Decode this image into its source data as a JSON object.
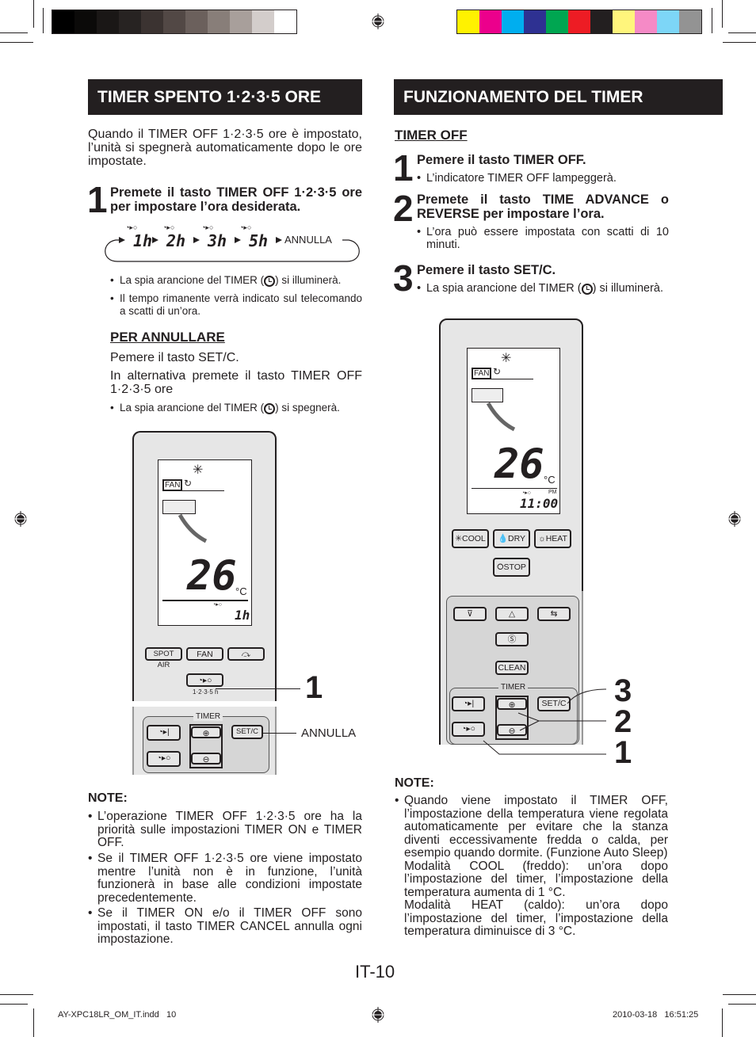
{
  "color_bars": {
    "grays": [
      "#000000",
      "#0b0a09",
      "#1a1716",
      "#272322",
      "#3b3331",
      "#524845",
      "#6b605c",
      "#887e79",
      "#a89f9b",
      "#d3cdcb",
      "#ffffff"
    ],
    "colors": [
      "#fff200",
      "#ec008c",
      "#00aeef",
      "#2e3192",
      "#00a651",
      "#ed1c24",
      "#231f20",
      "#fff57c",
      "#f58ac6",
      "#7dd6f7",
      "#939393"
    ]
  },
  "left": {
    "header": "TIMER SPENTO 1·2·3·5 ORE",
    "intro": "Quando il TIMER OFF 1·2·3·5 ore è impostato, l’unità si spegnerà automaticamente dopo le ore impostate.",
    "step1": {
      "num": "1",
      "title": "Premete il tasto TIMER OFF 1·2·3·5 ore per impostare l’ora desiderata."
    },
    "cycle": {
      "items": [
        "1h",
        "2h",
        "3h",
        "5h"
      ],
      "end": "ANNULLA"
    },
    "bullets": [
      {
        "pre": "La spia arancione del TIMER (",
        "post": ") si illuminerà."
      },
      {
        "text": "Il tempo rimanente verrà indicato sul telecomando a scatti di un’ora."
      }
    ],
    "cancel": {
      "heading": "PER ANNULLARE",
      "line1": "Pemere il tasto SET/C.",
      "line2": "In alternativa premete il tasto TIMER OFF 1·2·3·5 ore",
      "bullet_pre": "La spia arancione del TIMER (",
      "bullet_post": ") si spegnerà."
    },
    "remote": {
      "fan": "FAN",
      "temp": "26",
      "unit": "°C",
      "timer_value": "1h",
      "buttons": {
        "spot_air": "SPOT AIR",
        "fan": "FAN",
        "timer_sub": "1·2·3·5 h",
        "timer_label": "TIMER",
        "setc": "SET/C"
      },
      "callout_1": "1",
      "callout_annulla": "ANNULLA"
    },
    "note": {
      "heading": "NOTE:",
      "items": [
        "L’operazione TIMER OFF 1·2·3·5 ore ha la priorità sulle impostazioni TIMER ON  e TIMER OFF.",
        "Se il TIMER OFF 1·2·3·5 ore viene impostato mentre l’unità non è in funzione, l’unità funzionerà in base alle condizioni impostate precedentemente.",
        "Se il TIMER ON e/o il TIMER OFF sono impostati, il tasto TIMER CANCEL annulla ogni impostazione."
      ]
    }
  },
  "right": {
    "header": "FUNZIONAMENTO DEL TIMER",
    "subheading": "TIMER OFF",
    "steps": [
      {
        "num": "1",
        "title": "Pemere il tasto TIMER OFF.",
        "bullet": "L’indicatore TIMER OFF lampeggerà."
      },
      {
        "num": "2",
        "title": "Premete il tasto TIME ADVANCE o REVERSE per impostare l’ora.",
        "bullet": "L’ora può essere impostata con scatti di 10 minuti."
      },
      {
        "num": "3",
        "title": "Pemere il tasto SET/C.",
        "bullet_pre": "La spia arancione del TIMER (",
        "bullet_post": ") si illuminerà."
      }
    ],
    "remote": {
      "fan": "FAN",
      "temp": "26",
      "unit": "°C",
      "pm": "PM",
      "time": "11:00",
      "buttons": {
        "cool": "COOL",
        "dry": "DRY",
        "heat": "HEAT",
        "stop": "STOP",
        "clean": "CLEAN",
        "timer_label": "TIMER",
        "setc": "SET/C"
      },
      "callouts": [
        "3",
        "2",
        "1"
      ]
    },
    "note": {
      "heading": "NOTE:",
      "text": "Quando viene impostato il TIMER OFF, l’impostazione della temperatura viene regolata automaticamente per evitare che la stanza diventi eccessivamente fredda o calda, per esempio quando dormite. (Funzione Auto Sleep)",
      "cool": "Modalità COOL (freddo): un’ora dopo l’impostazione del timer, l’impostazione della temperatura aumenta di 1 °C.",
      "heat": "Modalità HEAT (caldo): un’ora dopo l’impostazione del timer, l’impostazione della temperatura diminuisce di 3 °C."
    }
  },
  "page_number": "IT-10",
  "footer": {
    "file": "AY-XPC18LR_OM_IT.indd   10",
    "timestamp": "2010-03-18   16:51:25"
  }
}
